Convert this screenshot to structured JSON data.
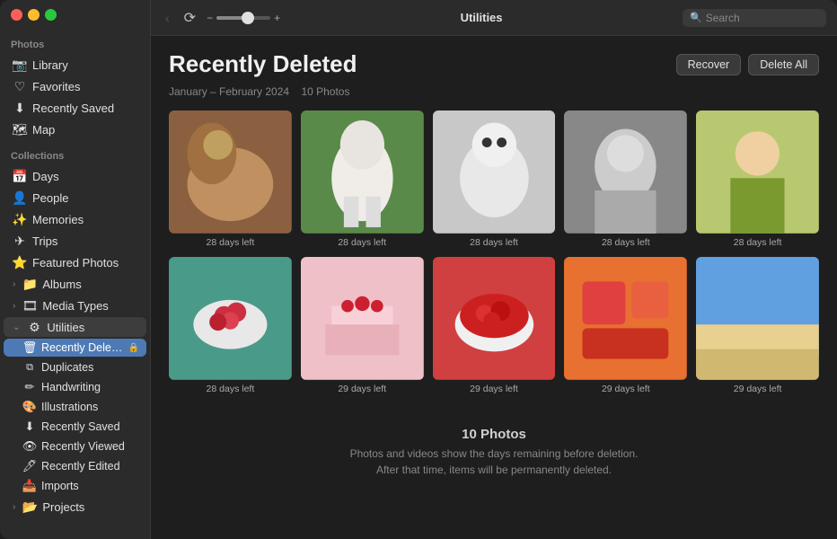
{
  "window": {
    "title": "Utilities"
  },
  "toolbar": {
    "back_label": "‹",
    "forward_label": "›",
    "zoom_minus": "−",
    "zoom_plus": "+",
    "search_placeholder": "Search"
  },
  "sidebar": {
    "photos_label": "Photos",
    "collections_label": "Collections",
    "photos_items": [
      {
        "id": "library",
        "label": "Library",
        "icon": "📷"
      },
      {
        "id": "favorites",
        "label": "Favorites",
        "icon": "♡"
      },
      {
        "id": "recently-saved",
        "label": "Recently Saved",
        "icon": "⬇"
      },
      {
        "id": "map",
        "label": "Map",
        "icon": "🗺"
      }
    ],
    "collections_items": [
      {
        "id": "days",
        "label": "Days",
        "icon": "📅"
      },
      {
        "id": "people",
        "label": "People",
        "icon": "👤"
      },
      {
        "id": "memories",
        "label": "Memories",
        "icon": "✨"
      },
      {
        "id": "trips",
        "label": "Trips",
        "icon": "✈"
      },
      {
        "id": "featured-photos",
        "label": "Featured Photos",
        "icon": "⭐"
      },
      {
        "id": "albums",
        "label": "Albums",
        "icon": "📁"
      },
      {
        "id": "media-types",
        "label": "Media Types",
        "icon": "🎞"
      },
      {
        "id": "utilities",
        "label": "Utilities",
        "icon": "⚙",
        "expanded": true
      }
    ],
    "utilities_sub_items": [
      {
        "id": "recently-deleted",
        "label": "Recently Delet...",
        "active": true,
        "icon": "🗑",
        "has_lock": true
      },
      {
        "id": "duplicates",
        "label": "Duplicates",
        "icon": "⧉"
      },
      {
        "id": "handwriting",
        "label": "Handwriting",
        "icon": "✏"
      },
      {
        "id": "illustrations",
        "label": "Illustrations",
        "icon": "🎨"
      },
      {
        "id": "recently-saved-sub",
        "label": "Recently Saved",
        "icon": "⬇"
      },
      {
        "id": "recently-viewed",
        "label": "Recently Viewed",
        "icon": "👁"
      },
      {
        "id": "recently-edited",
        "label": "Recently Edited",
        "icon": "🖊"
      },
      {
        "id": "imports",
        "label": "Imports",
        "icon": "📥"
      }
    ],
    "projects_label": "Projects",
    "projects_chevron": "›"
  },
  "content": {
    "title": "Recently Deleted",
    "subtitle": "January – February 2024",
    "photo_count_label": "10 Photos",
    "recover_label": "Recover",
    "delete_all_label": "Delete All",
    "photos": [
      {
        "id": 1,
        "days_left": "28 days left",
        "class": "p1"
      },
      {
        "id": 2,
        "days_left": "28 days left",
        "class": "p2"
      },
      {
        "id": 3,
        "days_left": "28 days left",
        "class": "p3"
      },
      {
        "id": 4,
        "days_left": "28 days left",
        "class": "p4"
      },
      {
        "id": 5,
        "days_left": "28 days left",
        "class": "p5"
      },
      {
        "id": 6,
        "days_left": "28 days left",
        "class": "p6"
      },
      {
        "id": 7,
        "days_left": "29 days left",
        "class": "p7"
      },
      {
        "id": 8,
        "days_left": "29 days left",
        "class": "p8"
      },
      {
        "id": 9,
        "days_left": "29 days left",
        "class": "p9"
      },
      {
        "id": 10,
        "days_left": "29 days left",
        "class": "p10"
      }
    ],
    "footer": {
      "title": "10 Photos",
      "line1": "Photos and videos show the days remaining before deletion.",
      "line2": "After that time, items will be permanently deleted."
    }
  }
}
